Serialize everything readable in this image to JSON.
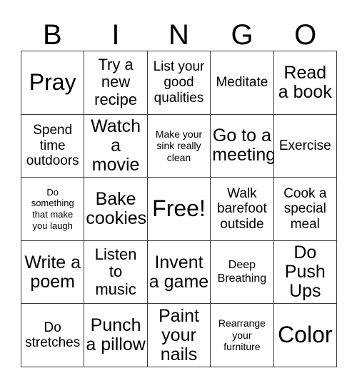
{
  "card": {
    "title_letters": [
      "B",
      "I",
      "N",
      "G",
      "O"
    ],
    "free_space_label": "Free!",
    "grid_size": "5x5",
    "colors": {
      "background": "#ffffff",
      "text": "#000000",
      "border": "#3c3c3c"
    },
    "rows": [
      [
        {
          "text": "Pray",
          "size": "fs-xxl"
        },
        {
          "text": "Try a\nnew\nrecipe",
          "size": "fs-lg"
        },
        {
          "text": "List your\ngood\nqualities",
          "size": "fs-md"
        },
        {
          "text": "Meditate",
          "size": "fs-md"
        },
        {
          "text": "Read\na book",
          "size": "fs-xl"
        }
      ],
      [
        {
          "text": "Spend\ntime\noutdoors",
          "size": "fs-md"
        },
        {
          "text": "Watch\na\nmovie",
          "size": "fs-xl"
        },
        {
          "text": "Make your\nsink really\nclean",
          "size": "fs-xs"
        },
        {
          "text": "Go to a\nmeeting",
          "size": "fs-xl"
        },
        {
          "text": "Exercise",
          "size": "fs-md"
        }
      ],
      [
        {
          "text": "Do\nsomething\nthat make\nyou laugh",
          "size": "fs-xxs"
        },
        {
          "text": "Bake\ncookies",
          "size": "fs-xl"
        },
        {
          "text": "Free!",
          "size": "fs-xxl"
        },
        {
          "text": "Walk\nbarefoot\noutside",
          "size": "fs-md"
        },
        {
          "text": "Cook a\nspecial\nmeal",
          "size": "fs-md"
        }
      ],
      [
        {
          "text": "Write a\npoem",
          "size": "fs-xl"
        },
        {
          "text": "Listen\nto\nmusic",
          "size": "fs-lg"
        },
        {
          "text": "Invent\na game",
          "size": "fs-xl"
        },
        {
          "text": "Deep\nBreathing",
          "size": "fs-sm"
        },
        {
          "text": "Do\nPush\nUps",
          "size": "fs-xl"
        }
      ],
      [
        {
          "text": "Do\nstretches",
          "size": "fs-md"
        },
        {
          "text": "Punch\na pillow",
          "size": "fs-xl"
        },
        {
          "text": "Paint\nyour\nnails",
          "size": "fs-xl"
        },
        {
          "text": "Rearrange\nyour\nfurniture",
          "size": "fs-xs"
        },
        {
          "text": "Color",
          "size": "fs-xxl"
        }
      ]
    ]
  }
}
